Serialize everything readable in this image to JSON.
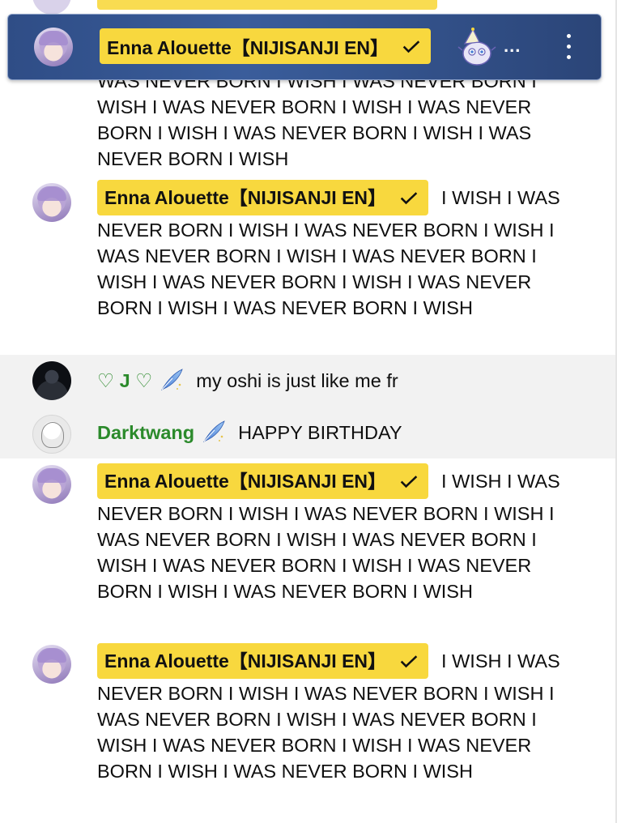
{
  "banner": {
    "author": "Enna Alouette【NIJISANJI EN】",
    "ellipsis": "...",
    "sticker": "mascot-sticker-icon",
    "menu_icon": "kebab-menu-icon"
  },
  "messages": [
    {
      "author": "Enna Alouette【NIJISANJI EN】",
      "verified": true,
      "text": "WAS NEVER BORN I WISH I WAS NEVER BORN I WISH I WAS NEVER BORN I WISH I WAS NEVER BORN I WISH I WAS NEVER BORN I WISH I WAS NEVER BORN I WISH"
    },
    {
      "author": "Enna Alouette【NIJISANJI EN】",
      "verified": true,
      "text": "I WISH I WAS NEVER BORN I WISH I WAS NEVER BORN I WISH I WAS NEVER BORN I WISH I WAS NEVER BORN I WISH I WAS NEVER BORN I WISH I WAS NEVER BORN I WISH I WAS NEVER BORN I WISH"
    },
    {
      "author": "♡ J ♡",
      "member": true,
      "text": "my oshi is just like me fr"
    },
    {
      "author": "Darktwang",
      "member": true,
      "text": "HAPPY BIRTHDAY"
    },
    {
      "author": "Enna Alouette【NIJISANJI EN】",
      "verified": true,
      "text": "I WISH I WAS NEVER BORN I WISH I WAS NEVER BORN I WISH I WAS NEVER BORN I WISH I WAS NEVER BORN I WISH I WAS NEVER BORN I WISH I WAS NEVER BORN I WISH I WAS NEVER BORN I WISH"
    },
    {
      "author": "Enna Alouette【NIJISANJI EN】",
      "verified": true,
      "text": "I WISH I WAS NEVER BORN I WISH I WAS NEVER BORN I WISH I WAS NEVER BORN I WISH I WAS NEVER BORN I WISH I WAS NEVER BORN I WISH I WAS NEVER BORN I WISH I WAS NEVER BORN I WISH"
    }
  ],
  "colors": {
    "owner_badge": "#f8d83e",
    "member_name": "#2b8a2b",
    "banner": "#2f4d86",
    "tinted_row": "#f2f2f2"
  }
}
